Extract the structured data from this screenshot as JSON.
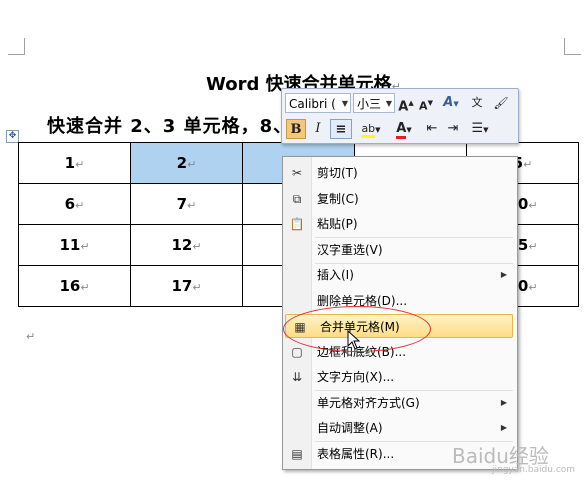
{
  "document": {
    "title": "Word 快速合并单元格",
    "subtitle": "快速合并 2、3 单元格，8、",
    "paragraph_mark": "↵",
    "table": [
      [
        "1",
        "2",
        "",
        "",
        "5"
      ],
      [
        "6",
        "7",
        "",
        "",
        "10"
      ],
      [
        "11",
        "12",
        "",
        "",
        "15"
      ],
      [
        "16",
        "17",
        "",
        "",
        "20"
      ]
    ],
    "selected_cells": [
      "2",
      "3"
    ]
  },
  "mini_toolbar": {
    "font": "Calibri (",
    "size": "小三",
    "grow_font": "A",
    "shrink_font": "A",
    "styles": "A",
    "phonetic": "文",
    "format_painter": "🖌",
    "bold": "B",
    "italic": "I",
    "center": "≡",
    "highlight": "ab",
    "font_color": "A",
    "decrease_indent": "⇤",
    "increase_indent": "⇥",
    "bullets": "☰",
    "highlight_color": "#ffff00",
    "font_color_value": "#e02020"
  },
  "context_menu": {
    "items": [
      {
        "label": "剪切(T)",
        "icon": "scissors-icon",
        "glyph": "✂"
      },
      {
        "label": "复制(C)",
        "icon": "copy-icon",
        "glyph": "⧉"
      },
      {
        "label": "粘贴(P)",
        "icon": "paste-icon",
        "glyph": "📋"
      },
      {
        "label": "汉字重选(V)",
        "icon": "",
        "glyph": ""
      },
      {
        "label": "插入(I)",
        "icon": "",
        "glyph": "",
        "submenu": true
      },
      {
        "label": "删除单元格(D)...",
        "icon": "",
        "glyph": ""
      },
      {
        "label": "合并单元格(M)",
        "icon": "merge-cells-icon",
        "glyph": "▦",
        "highlighted": true
      },
      {
        "label": "边框和底纹(B)...",
        "icon": "borders-icon",
        "glyph": "▢"
      },
      {
        "label": "文字方向(X)...",
        "icon": "text-direction-icon",
        "glyph": "⇊"
      },
      {
        "label": "单元格对齐方式(G)",
        "icon": "",
        "glyph": "",
        "submenu": true
      },
      {
        "label": "自动调整(A)",
        "icon": "",
        "glyph": "",
        "submenu": true
      },
      {
        "label": "表格属性(R)...",
        "icon": "table-properties-icon",
        "glyph": "▤"
      }
    ],
    "submenu_arrow": "▶"
  },
  "watermark": {
    "text": "Baidu经验",
    "url": "jingyan.baidu.com"
  },
  "colors": {
    "selection": "#aed2f0",
    "highlight_annotation": "#e03030"
  }
}
